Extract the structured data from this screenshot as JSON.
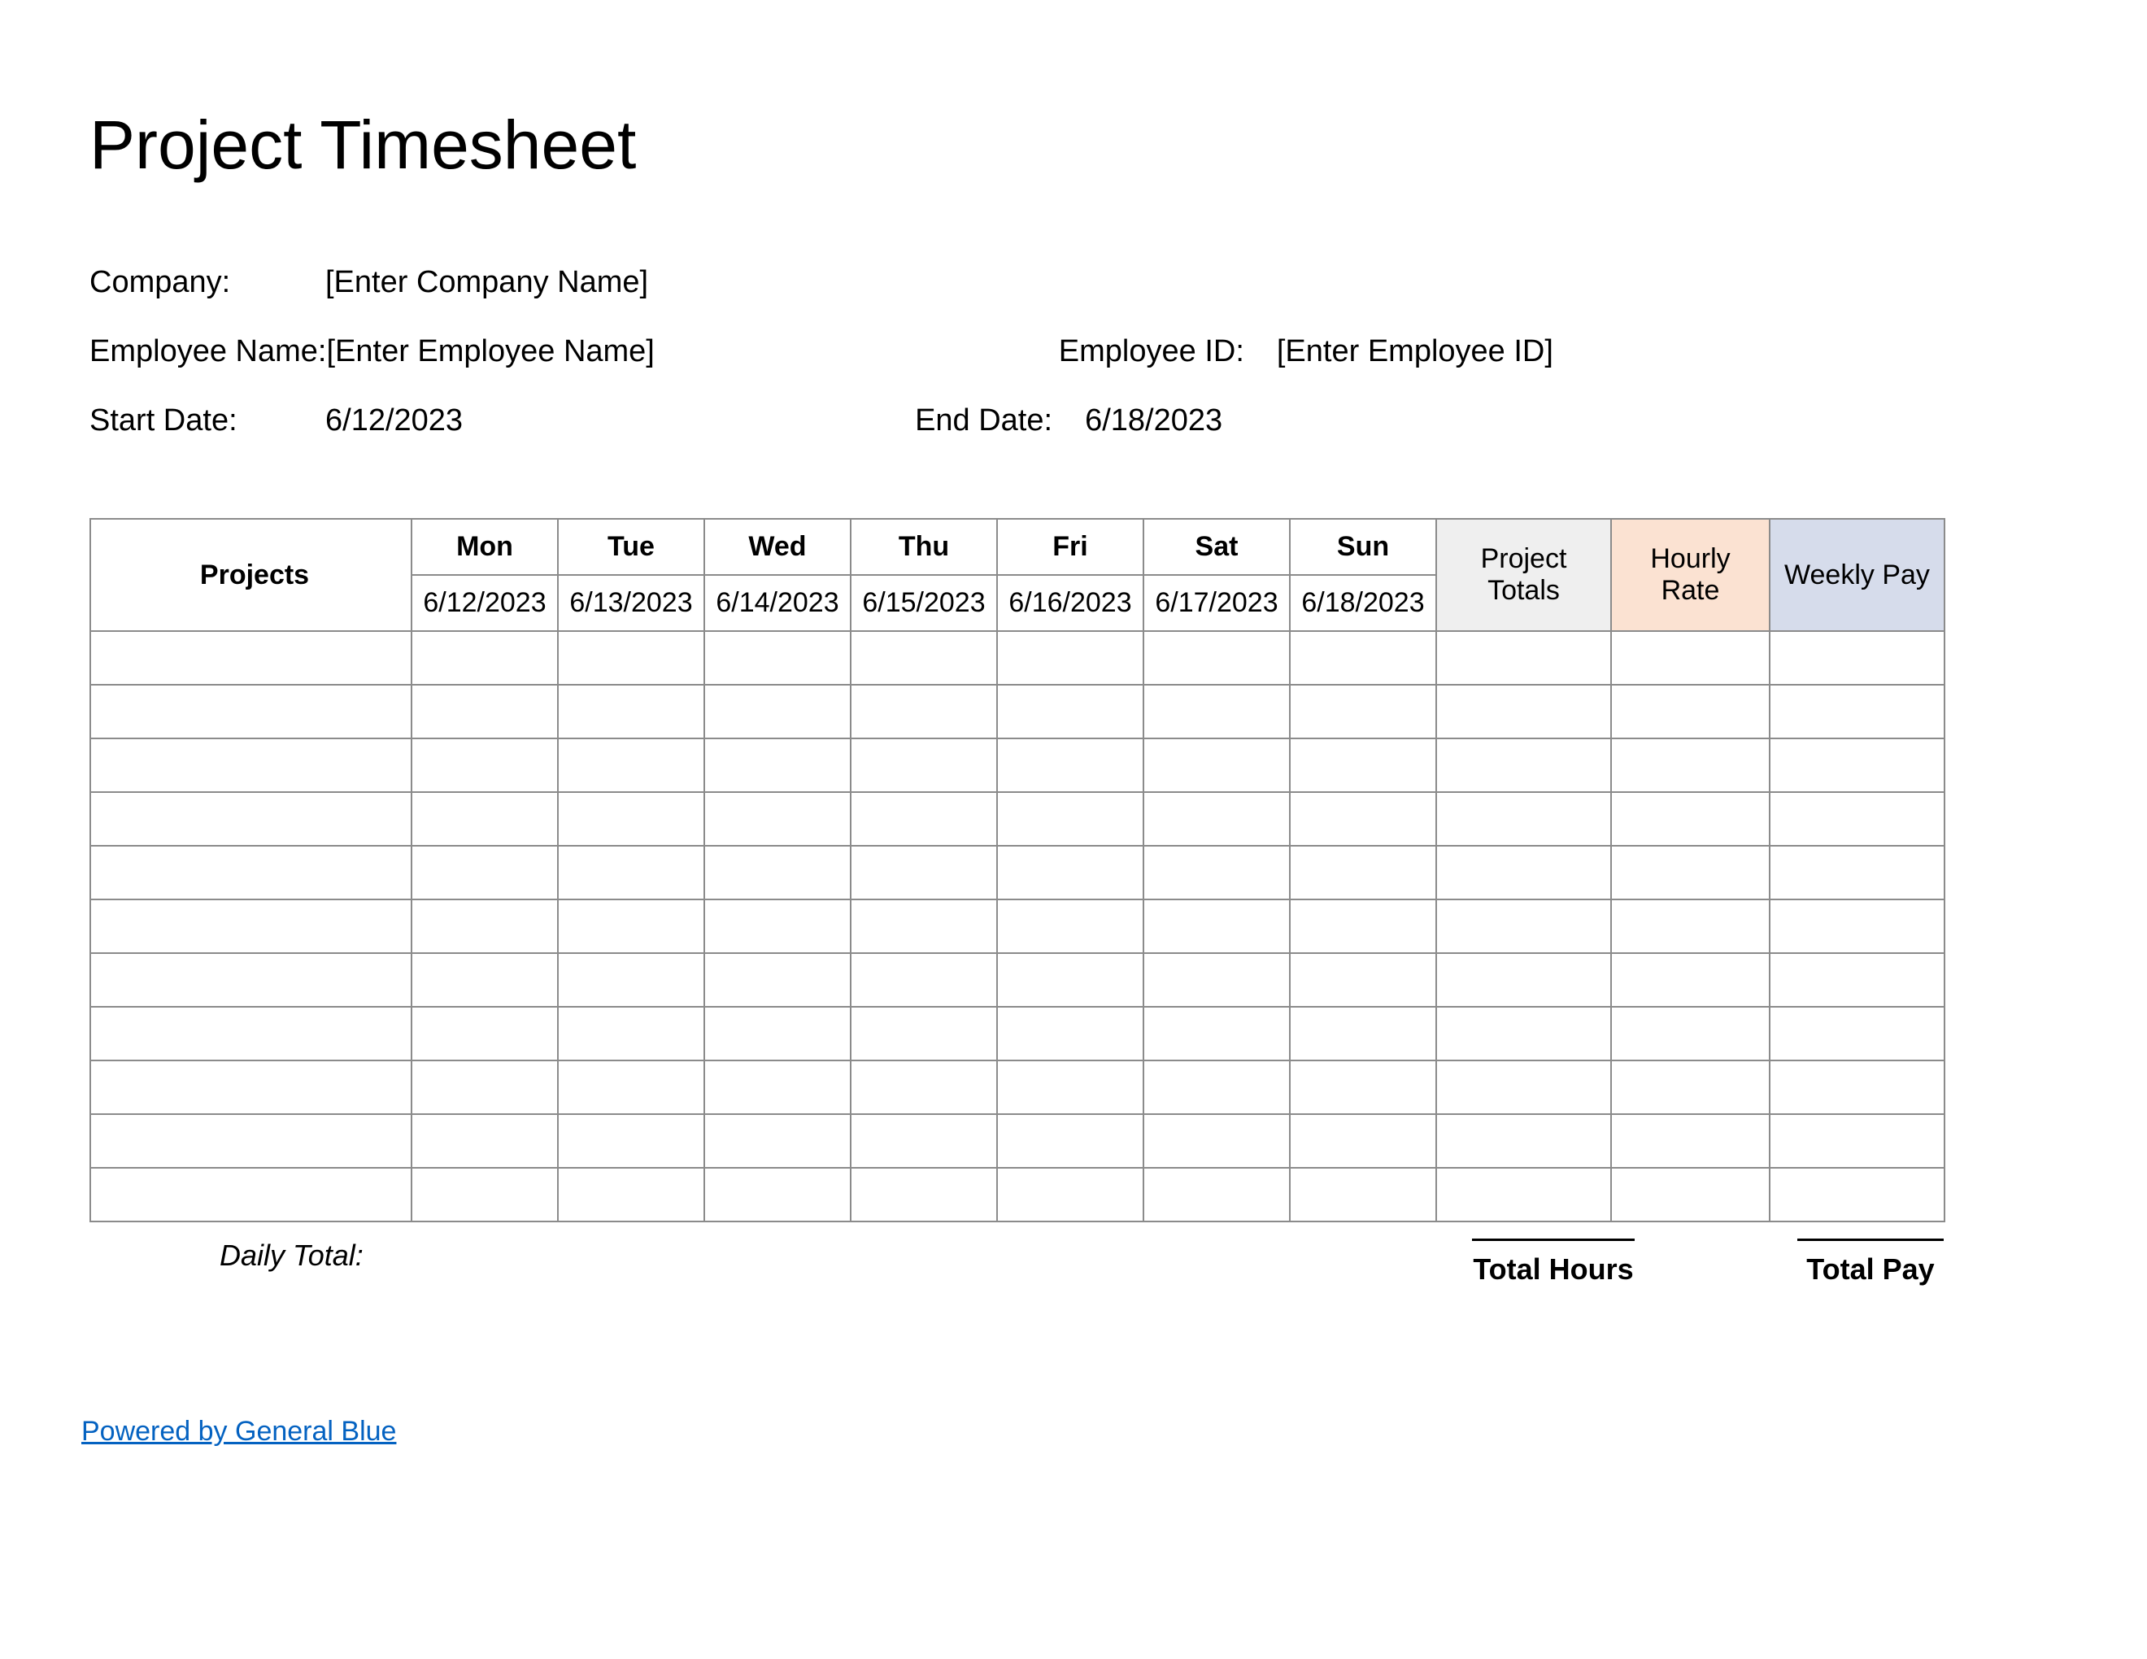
{
  "title": "Project Timesheet",
  "info": {
    "company_label": "Company:",
    "company_value": "[Enter Company Name]",
    "employee_name_label": "Employee Name:",
    "employee_name_value": "[Enter Employee Name]",
    "employee_id_label": "Employee ID:",
    "employee_id_value": "[Enter Employee ID]",
    "start_date_label": "Start Date:",
    "start_date_value": "6/12/2023",
    "end_date_label": "End Date:",
    "end_date_value": "6/18/2023"
  },
  "table": {
    "projects_header": "Projects",
    "days": [
      {
        "name": "Mon",
        "date": "6/12/2023"
      },
      {
        "name": "Tue",
        "date": "6/13/2023"
      },
      {
        "name": "Wed",
        "date": "6/14/2023"
      },
      {
        "name": "Thu",
        "date": "6/15/2023"
      },
      {
        "name": "Fri",
        "date": "6/16/2023"
      },
      {
        "name": "Sat",
        "date": "6/17/2023"
      },
      {
        "name": "Sun",
        "date": "6/18/2023"
      }
    ],
    "summary_headers": {
      "project_totals": "Project Totals",
      "hourly_rate": "Hourly Rate",
      "weekly_pay": "Weekly Pay"
    },
    "row_count": 11
  },
  "footer": {
    "daily_total_label": "Daily Total:",
    "total_hours_label": "Total Hours",
    "total_pay_label": "Total Pay",
    "powered_by": "Powered by General Blue"
  }
}
